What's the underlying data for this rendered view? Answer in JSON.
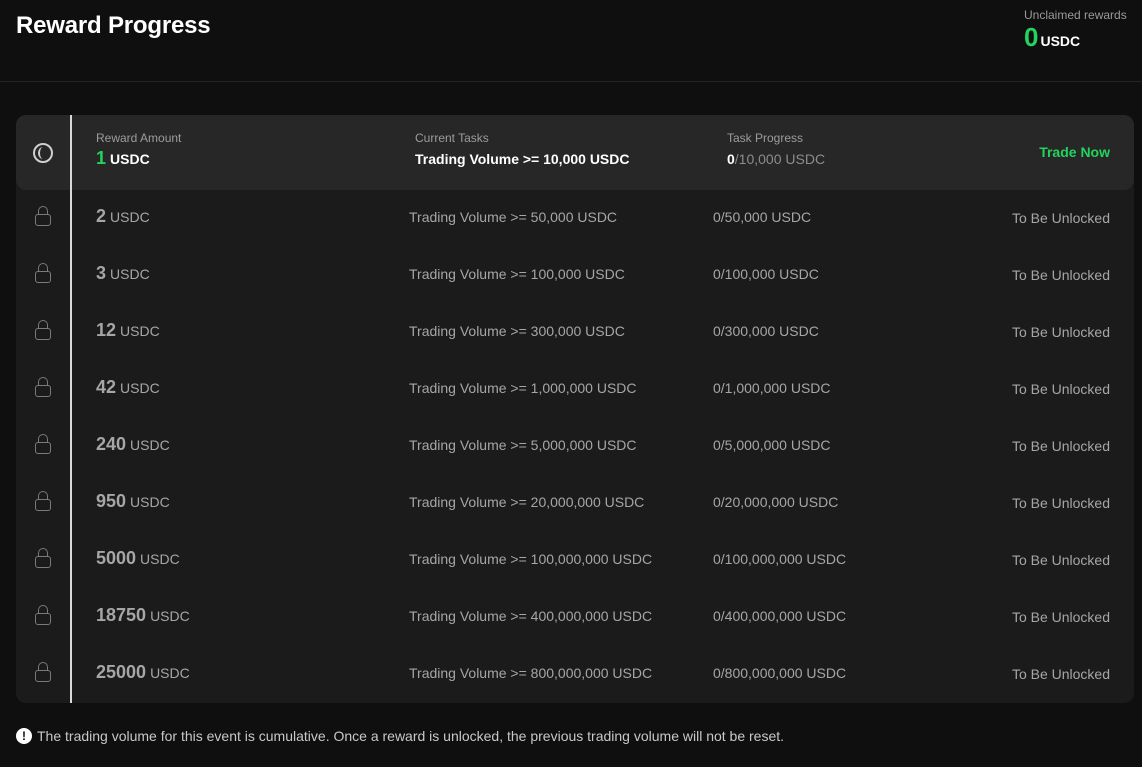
{
  "header": {
    "title": "Reward Progress",
    "unclaimed_label": "Unclaimed rewards",
    "unclaimed_value": "0",
    "unclaimed_unit": "USDC"
  },
  "active": {
    "reward_label": "Reward Amount",
    "reward_value": "1",
    "reward_unit": "USDC",
    "task_label": "Current Tasks",
    "task_value": "Trading Volume >= 10,000 USDC",
    "progress_label": "Task Progress",
    "progress_current": "0",
    "progress_target": "/10,000 USDC",
    "action_label": "Trade Now"
  },
  "rows": [
    {
      "amount": "2",
      "unit": "USDC",
      "task": "Trading Volume >= 50,000 USDC",
      "progress": "0/50,000 USDC",
      "status": "To Be Unlocked"
    },
    {
      "amount": "3",
      "unit": "USDC",
      "task": "Trading Volume >= 100,000 USDC",
      "progress": "0/100,000 USDC",
      "status": "To Be Unlocked"
    },
    {
      "amount": "12",
      "unit": "USDC",
      "task": "Trading Volume >= 300,000 USDC",
      "progress": "0/300,000 USDC",
      "status": "To Be Unlocked"
    },
    {
      "amount": "42",
      "unit": "USDC",
      "task": "Trading Volume >= 1,000,000 USDC",
      "progress": "0/1,000,000 USDC",
      "status": "To Be Unlocked"
    },
    {
      "amount": "240",
      "unit": "USDC",
      "task": "Trading Volume >= 5,000,000 USDC",
      "progress": "0/5,000,000 USDC",
      "status": "To Be Unlocked"
    },
    {
      "amount": "950",
      "unit": "USDC",
      "task": "Trading Volume >= 20,000,000 USDC",
      "progress": "0/20,000,000 USDC",
      "status": "To Be Unlocked"
    },
    {
      "amount": "5000",
      "unit": "USDC",
      "task": "Trading Volume >= 100,000,000 USDC",
      "progress": "0/100,000,000 USDC",
      "status": "To Be Unlocked"
    },
    {
      "amount": "18750",
      "unit": "USDC",
      "task": "Trading Volume >= 400,000,000 USDC",
      "progress": "0/400,000,000 USDC",
      "status": "To Be Unlocked"
    },
    {
      "amount": "25000",
      "unit": "USDC",
      "task": "Trading Volume >= 800,000,000 USDC",
      "progress": "0/800,000,000 USDC",
      "status": "To Be Unlocked"
    }
  ],
  "footnote": {
    "icon": "!",
    "text": "The trading volume for this event is cumulative. Once a reward is unlocked, the previous trading volume will not be reset."
  },
  "colors": {
    "accent": "#22d35e",
    "background": "#0f0f0f",
    "panel": "#1b1b1b"
  }
}
